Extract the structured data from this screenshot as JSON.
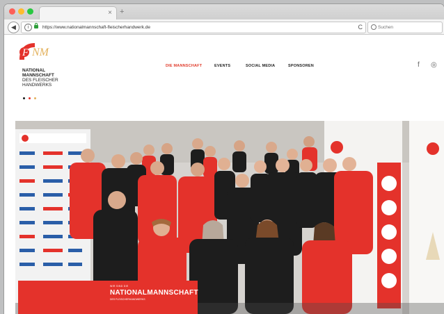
{
  "browser": {
    "tab_close": "×",
    "new_tab": "+",
    "back": "◀",
    "url": "https://www.nationalmannschaft-fleischerhandwerk.de",
    "reload": "C",
    "search_placeholder": "Suchen"
  },
  "brand": {
    "mark": "FNM",
    "lines": [
      "NATIONAL",
      "MANNSCHAFT",
      "DES FLEISCHER",
      "HANDWERKS"
    ],
    "colors": {
      "red": "#e4322b",
      "gold": "#e3b15c",
      "black": "#1a1a1a"
    }
  },
  "nav": {
    "items": [
      "DIE MANNSCHAFT",
      "EVENTS",
      "SOCIAL MEDIA",
      "SPONSOREN"
    ],
    "active_index": 0
  },
  "social": {
    "facebook": "f",
    "instagram": "◎"
  },
  "hero": {
    "caption_small": "WIR SIND DIE",
    "caption_title": "NATIONALMANNSCHAFT",
    "caption_sub": "DES FLEISCHERHANDWERKS"
  }
}
